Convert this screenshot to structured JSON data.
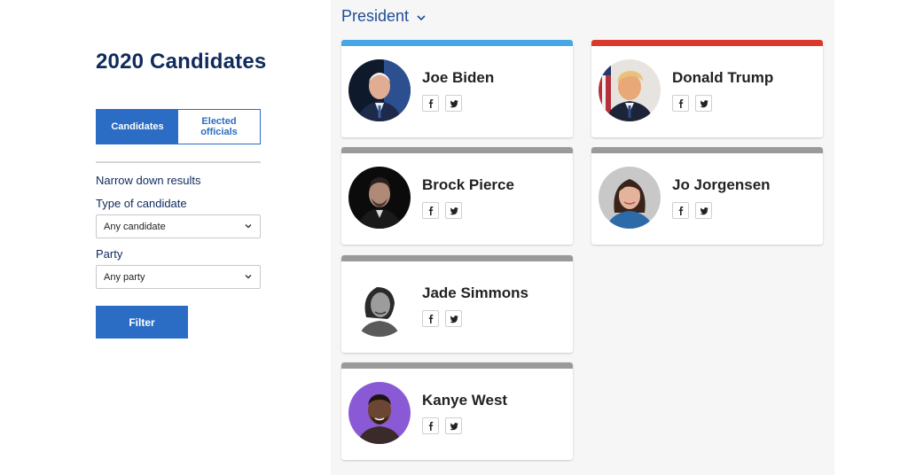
{
  "sidebar": {
    "title": "2020 Candidates",
    "toggle": {
      "candidates": "Candidates",
      "elected_line1": "Elected",
      "elected_line2": "officials"
    },
    "narrow_label": "Narrow down results",
    "type_label": "Type of candidate",
    "type_value": "Any candidate",
    "party_label": "Party",
    "party_value": "Any party",
    "filter_label": "Filter"
  },
  "main": {
    "office_label": "President"
  },
  "colors": {
    "accent": "#2b6cc4",
    "democrat": "#47a7e6",
    "republican": "#d8392b",
    "other": "#9a9a9a"
  },
  "candidates": [
    {
      "name": "Joe Biden",
      "party_color": "#47a7e6",
      "icons": [
        "facebook-icon",
        "twitter-icon"
      ]
    },
    {
      "name": "Donald Trump",
      "party_color": "#d8392b",
      "icons": [
        "facebook-icon",
        "twitter-icon"
      ]
    },
    {
      "name": "Brock Pierce",
      "party_color": "#9a9a9a",
      "icons": [
        "facebook-icon",
        "twitter-icon"
      ]
    },
    {
      "name": "Jo Jorgensen",
      "party_color": "#9a9a9a",
      "icons": [
        "facebook-icon",
        "twitter-icon"
      ]
    },
    {
      "name": "Jade Simmons",
      "party_color": "#9a9a9a",
      "icons": [
        "facebook-icon",
        "twitter-icon"
      ]
    },
    {
      "name": "Kanye West",
      "party_color": "#9a9a9a",
      "icons": [
        "facebook-icon",
        "twitter-icon"
      ]
    }
  ]
}
